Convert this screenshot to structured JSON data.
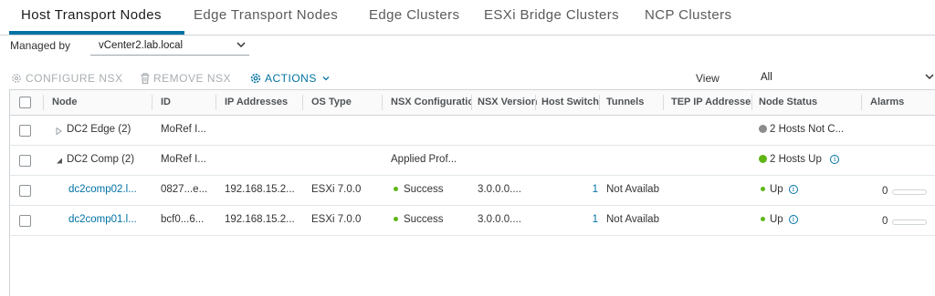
{
  "tabs": [
    "Host Transport Nodes",
    "Edge Transport Nodes",
    "Edge Clusters",
    "ESXi Bridge Clusters",
    "NCP Clusters"
  ],
  "managed_by": {
    "label": "Managed by",
    "value": "vCenter2.lab.local"
  },
  "toolbar": {
    "configure": "CONFIGURE NSX",
    "remove": "REMOVE NSX",
    "actions": "ACTIONS"
  },
  "view": {
    "label": "View",
    "value": "All"
  },
  "columns": [
    "Node",
    "ID",
    "IP Addresses",
    "OS Type",
    "NSX Configuratio",
    "NSX Version",
    "Host Switch",
    "Tunnels",
    "TEP IP Addresses",
    "Node Status",
    "Alarms"
  ],
  "rows": [
    {
      "node": "DC2 Edge (2)",
      "id": "MoRef I...",
      "status": "2 Hosts Not C..."
    },
    {
      "node": "DC2 Comp (2)",
      "id": "MoRef I...",
      "nsx_config": "Applied Prof...",
      "status": "2 Hosts Up"
    },
    {
      "node": "dc2comp02.l...",
      "id": "0827...e...",
      "ip": "192.168.15.2...",
      "os": "ESXi 7.0.0",
      "nsx_config": "Success",
      "version": "3.0.0.0....",
      "host_switch": "1",
      "tunnels": "Not Availab",
      "status": "Up",
      "alarms": "0"
    },
    {
      "node": "dc2comp01.l...",
      "id": "bcf0...6...",
      "ip": "192.168.15.2...",
      "os": "ESXi 7.0.0",
      "nsx_config": "Success",
      "version": "3.0.0.0....",
      "host_switch": "1",
      "tunnels": "Not Availab",
      "status": "Up",
      "alarms": "0"
    }
  ],
  "colors": {
    "accent": "#0072a3",
    "success": "#60b515",
    "unknown": "#8c8c8c"
  }
}
